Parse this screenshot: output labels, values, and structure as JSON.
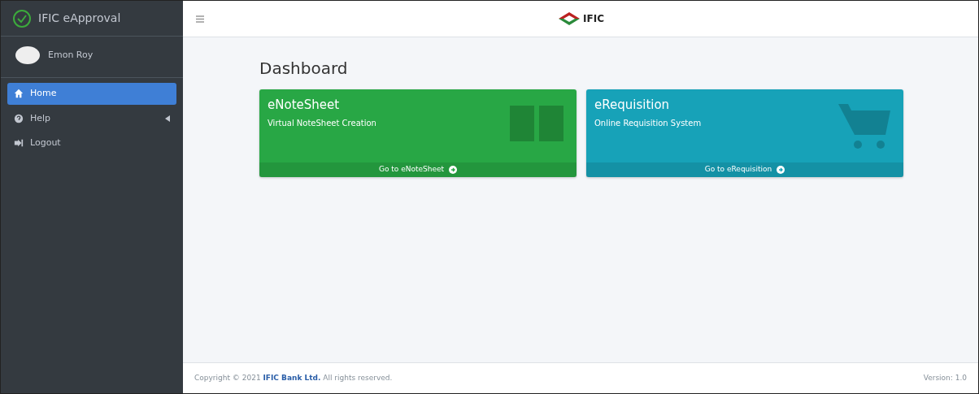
{
  "sidebar": {
    "brand": "IFIC eApproval",
    "user": "Emon Roy",
    "items": [
      {
        "label": "Home",
        "kind": "home",
        "selected": true,
        "has_children": false
      },
      {
        "label": "Help",
        "kind": "help",
        "selected": false,
        "has_children": true
      },
      {
        "label": "Logout",
        "kind": "logout",
        "selected": false,
        "has_children": false
      }
    ]
  },
  "header": {
    "logo_text": "IFIC"
  },
  "page_title": "Dashboard",
  "cards": [
    {
      "title": "eNoteSheet",
      "subtitle": "Virtual NoteSheet Creation",
      "link": "Go to eNoteSheet",
      "color": "#28a745",
      "kind": "book"
    },
    {
      "title": "eRequisition",
      "subtitle": "Online Requisition System",
      "link": "Go to eRequisition",
      "color": "#17a2b8",
      "kind": "cart"
    }
  ],
  "footer": {
    "prefix": "Copyright © 2021",
    "company": "IFIC Bank Ltd.",
    "suffix": "All rights reserved.",
    "version": "Version: 1.0"
  }
}
